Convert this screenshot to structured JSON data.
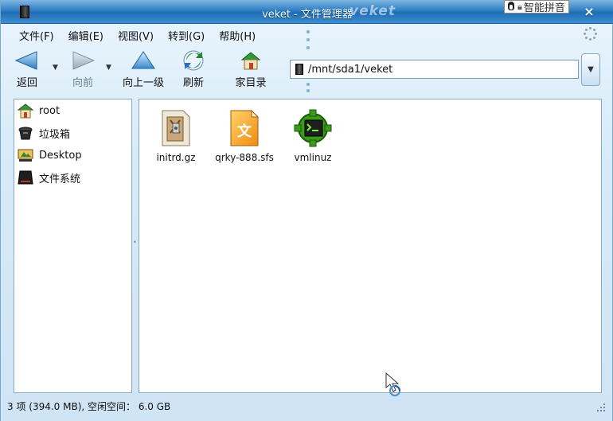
{
  "window": {
    "title": "veket - 文件管理器",
    "brand": "veket",
    "close_glyph": "×"
  },
  "ime": {
    "label": "智能拼音",
    "icons": [
      "tux-icon",
      "lock-icon"
    ]
  },
  "menu": [
    {
      "label": "文件(F)"
    },
    {
      "label": "编辑(E)"
    },
    {
      "label": "视图(V)"
    },
    {
      "label": "转到(G)"
    },
    {
      "label": "帮助(H)"
    }
  ],
  "toolbar": {
    "back": "返回",
    "forward": "向前",
    "up": "向上一级",
    "refresh": "刷新",
    "home": "家目录",
    "dropdown_glyph": "▼"
  },
  "location": {
    "path": "/mnt/sda1/veket",
    "dropdown_glyph": "▼"
  },
  "sidebar": {
    "items": [
      {
        "label": "root",
        "icon": "home-icon"
      },
      {
        "label": "垃圾箱",
        "icon": "trash-icon"
      },
      {
        "label": "Desktop",
        "icon": "desktop-icon"
      },
      {
        "label": "文件系统",
        "icon": "drive-icon"
      }
    ]
  },
  "files": [
    {
      "name": "initrd.gz",
      "icon": "archive-icon"
    },
    {
      "name": "qrky-888.sfs",
      "icon": "document-icon"
    },
    {
      "name": "vmlinuz",
      "icon": "executable-icon"
    }
  ],
  "status": {
    "text": "3 项 (394.0 MB), 空闲空间： 6.0 GB"
  },
  "colors": {
    "titlebar": "#2f7fc4",
    "window_bg": "#d6eaf8",
    "pane_border": "#8aa8c2"
  }
}
